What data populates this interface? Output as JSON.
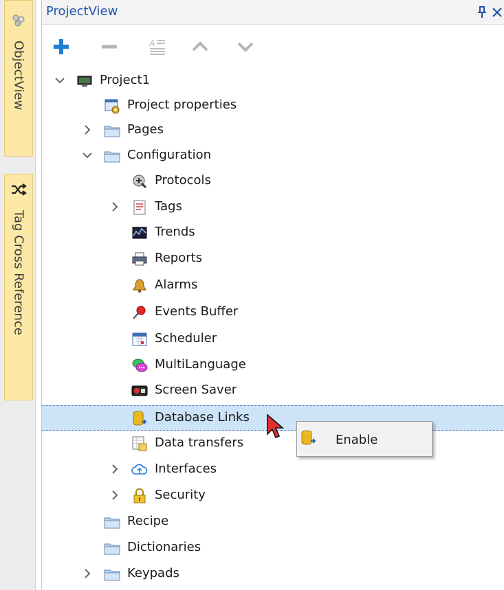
{
  "left_strip": {
    "tabs": [
      {
        "label": "ObjectView",
        "icon": "objectview-icon"
      },
      {
        "label": "Tag Cross Reference",
        "icon": "shuffle-icon"
      }
    ]
  },
  "panel": {
    "title": "ProjectView",
    "pin_glyph": "ᵐ",
    "close_glyph": "×"
  },
  "toolbar": {
    "buttons": [
      "add-icon",
      "remove-icon",
      "rename-icon",
      "move-up-icon",
      "move-down-icon"
    ]
  },
  "tree": {
    "items": [
      {
        "label": "Project1",
        "expand": "expanded",
        "icon": "monitor-icon"
      },
      {
        "label": "Project properties",
        "expand": "none",
        "icon": "properties-icon"
      },
      {
        "label": "Pages",
        "expand": "collapsed",
        "icon": "folder-icon"
      },
      {
        "label": "Configuration",
        "expand": "expanded",
        "icon": "folder-icon"
      },
      {
        "label": "Protocols",
        "expand": "none",
        "icon": "protocols-icon"
      },
      {
        "label": "Tags",
        "expand": "collapsed",
        "icon": "tags-icon"
      },
      {
        "label": "Trends",
        "expand": "none",
        "icon": "trends-icon"
      },
      {
        "label": "Reports",
        "expand": "none",
        "icon": "printer-icon"
      },
      {
        "label": "Alarms",
        "expand": "none",
        "icon": "bell-icon"
      },
      {
        "label": "Events Buffer",
        "expand": "none",
        "icon": "pin-icon"
      },
      {
        "label": "Scheduler",
        "expand": "none",
        "icon": "calendar-icon"
      },
      {
        "label": "MultiLanguage",
        "expand": "none",
        "icon": "speech-bubbles-icon"
      },
      {
        "label": "Screen Saver",
        "expand": "none",
        "icon": "screen-saver-icon"
      },
      {
        "label": "Database Links",
        "expand": "none",
        "icon": "database-icon",
        "selected": true
      },
      {
        "label": "Data transfers",
        "expand": "none",
        "icon": "data-transfer-icon"
      },
      {
        "label": "Interfaces",
        "expand": "collapsed",
        "icon": "cloud-icon"
      },
      {
        "label": "Security",
        "expand": "collapsed",
        "icon": "lock-icon"
      },
      {
        "label": "Recipe",
        "expand": "none",
        "icon": "folder-icon"
      },
      {
        "label": "Dictionaries",
        "expand": "none",
        "icon": "folder-icon"
      },
      {
        "label": "Keypads",
        "expand": "collapsed",
        "icon": "folder-icon"
      }
    ]
  },
  "context_menu": {
    "items": [
      {
        "label": "Enable",
        "icon": "database-enable-icon"
      }
    ]
  },
  "colors": {
    "accent": "#2255a8",
    "selection": "#cde3f8",
    "tab_bg": "#fbe7a6",
    "add_plus": "#1e7fd6"
  }
}
